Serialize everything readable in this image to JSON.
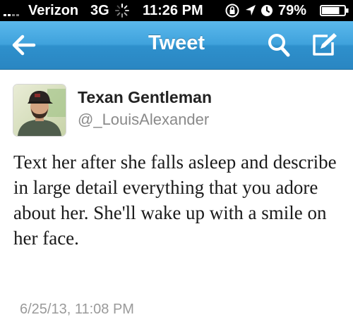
{
  "status_bar": {
    "carrier": "Verizon",
    "network": "3G",
    "time": "11:26 PM",
    "battery_percent": "79%",
    "battery_level": 0.79,
    "icons": [
      "signal-icon",
      "activity-icon",
      "rotation-lock-icon",
      "location-icon",
      "alarm-icon",
      "battery-icon"
    ]
  },
  "nav": {
    "title": "Tweet",
    "icons": [
      "back-arrow-icon",
      "search-icon",
      "compose-icon"
    ],
    "background": "#3fa2dc"
  },
  "tweet": {
    "display_name": "Texan Gentleman",
    "handle": "@_LouisAlexander",
    "text": "Text her after she falls asleep and describe in large detail everything that you adore about her. She'll wake up with a smile on her face.",
    "timestamp": "6/25/13, 11:08 PM"
  }
}
